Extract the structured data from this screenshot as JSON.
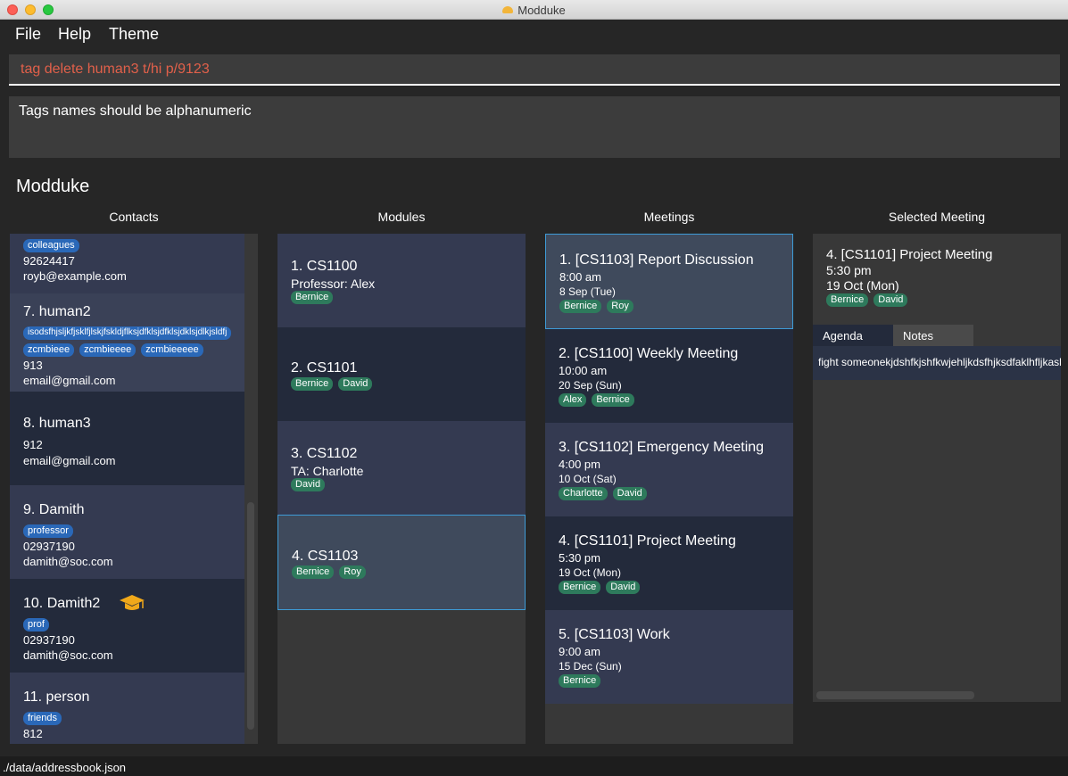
{
  "window": {
    "title": "Modduke"
  },
  "menu": {
    "file": "File",
    "help": "Help",
    "theme": "Theme"
  },
  "command": {
    "value": "tag delete human3 t/hi p/9123"
  },
  "result": {
    "text": "Tags names should be alphanumeric"
  },
  "app_heading": "Modduke",
  "columns": {
    "contacts": "Contacts",
    "modules": "Modules",
    "meetings": "Meetings",
    "selected": "Selected Meeting"
  },
  "contacts": [
    {
      "name": "",
      "tags": [
        "colleagues"
      ],
      "phone": "92624417",
      "email": "royb@example.com"
    },
    {
      "name": "7.  human2",
      "tags": [
        "isodsfhjsljkfjsklfjlskjfskldjflksjdfklsjdfklsjdklsjdlkjsldfj"
      ],
      "tags2": [
        "zcmbieee",
        "zcmbieeee",
        "zcmbieeeee"
      ],
      "phone": "913",
      "email": "email@gmail.com"
    },
    {
      "name": "8.  human3",
      "tags": [],
      "phone": "912",
      "email": "email@gmail.com"
    },
    {
      "name": "9.  Damith",
      "tags": [
        "professor"
      ],
      "phone": "02937190",
      "email": "damith@soc.com"
    },
    {
      "name": "10.  Damith2",
      "tags": [
        "prof"
      ],
      "phone": "02937190",
      "email": "damith@soc.com",
      "icon": "graduation-cap-icon"
    },
    {
      "name": "11.  person",
      "tags": [
        "friends"
      ],
      "phone": "812",
      "email": ""
    }
  ],
  "modules": [
    {
      "title": "1.  CS1100",
      "subtitle": "Professor: Alex",
      "tags": [
        "Bernice"
      ]
    },
    {
      "title": "2.  CS1101",
      "subtitle": "",
      "tags": [
        "Bernice",
        "David"
      ]
    },
    {
      "title": "3.  CS1102",
      "subtitle": "TA: Charlotte",
      "tags": [
        "David"
      ]
    },
    {
      "title": "4.  CS1103",
      "subtitle": "",
      "tags": [
        "Bernice",
        "Roy"
      ]
    }
  ],
  "meetings": [
    {
      "title": "1.  [CS1103] Report Discussion",
      "time": "8:00 am",
      "date": "8 Sep (Tue)",
      "tags": [
        "Bernice",
        "Roy"
      ]
    },
    {
      "title": "2.  [CS1100] Weekly Meeting",
      "time": "10:00 am",
      "date": "20 Sep (Sun)",
      "tags": [
        "Alex",
        "Bernice"
      ]
    },
    {
      "title": "3.  [CS1102] Emergency Meeting",
      "time": "4:00 pm",
      "date": "10 Oct (Sat)",
      "tags": [
        "Charlotte",
        "David"
      ]
    },
    {
      "title": "4.  [CS1101] Project Meeting",
      "time": "5:30 pm",
      "date": "19 Oct (Mon)",
      "tags": [
        "Bernice",
        "David"
      ]
    },
    {
      "title": "5.  [CS1103] Work",
      "time": "9:00 am",
      "date": "15 Dec (Sun)",
      "tags": [
        "Bernice"
      ]
    }
  ],
  "selected_meeting": {
    "title": "4.  [CS1101] Project Meeting",
    "time": "5:30 pm",
    "date": "19 Oct (Mon)",
    "tags": [
      "Bernice",
      "David"
    ],
    "tab_agenda": "Agenda",
    "tab_notes": "Notes",
    "agenda_text": "fight someonekjdshfkjshfkwjehljkdsfhjksdfaklhfljkaskdjfh"
  },
  "status": {
    "path": "./data/addressbook.json"
  },
  "colors": {
    "accent_command": "#e1604a",
    "tag_blue": "#2a68b8",
    "tag_green": "#2e7a5c",
    "selection_border": "#3e9bd6"
  }
}
